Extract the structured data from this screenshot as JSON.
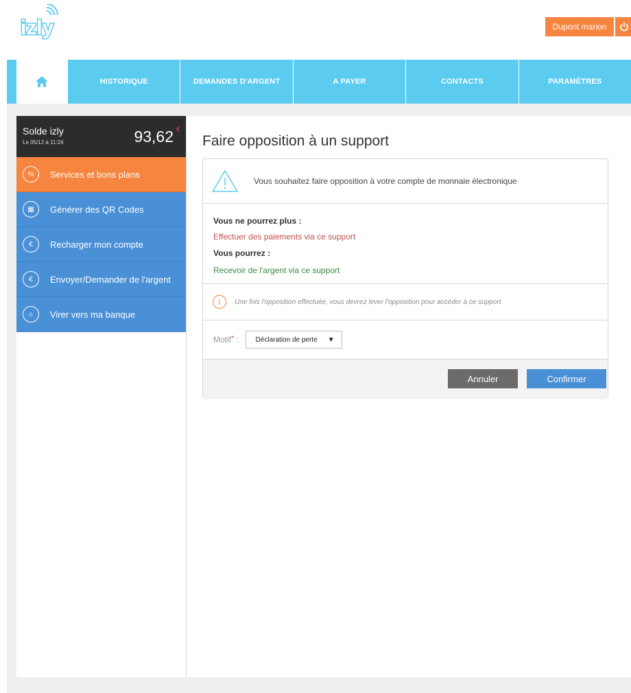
{
  "header": {
    "logo_text": "izly",
    "user_label": "Dupont marion",
    "icons": {
      "logo": "izly-logo",
      "power": "power-icon"
    }
  },
  "nav": {
    "home_icon": "home-icon",
    "items": [
      "HISTORIQUE",
      "DEMANDES D'ARGENT",
      "A PAYER",
      "CONTACTS",
      "PARAMÈTRES"
    ]
  },
  "sidebar": {
    "balance_label": "Solde izly",
    "balance_date": "Le 05/12 à 11:24",
    "balance_amount": "93,62",
    "balance_currency": "€",
    "items": [
      {
        "label": "Services et bons plans",
        "icon": "percent-icon",
        "glyph": "%"
      },
      {
        "label": "Générer des QR Codes",
        "icon": "qr-code-icon",
        "glyph": "▦"
      },
      {
        "label": "Recharger mon compte",
        "icon": "euro-refresh-icon",
        "glyph": "€"
      },
      {
        "label": "Envoyer/Demander de l'argent",
        "icon": "euro-send-icon",
        "glyph": "€"
      },
      {
        "label": "Virer vers ma banque",
        "icon": "bank-icon",
        "glyph": "⌂"
      }
    ]
  },
  "main": {
    "title": "Faire opposition à un support",
    "warning": "Vous souhaitez faire opposition à votre compte de monnaie électronique",
    "cannot_label": "Vous ne pourrez plus :",
    "cannot_item": "Effectuer des paiements via ce support",
    "can_label": "Vous pourrez :",
    "can_item": "Recevoir de l'argent via ce support",
    "note_glyph": "i",
    "note": "Une fois l'opposition effectuée, vous devrez lever l'opposition pour accéder à ce support",
    "motif_label": "Motif",
    "motif_required": "*",
    "motif_colon": " :",
    "motif_value": "Déclaration de perte",
    "cancel_label": "Annuler",
    "confirm_label": "Confirmer"
  },
  "colors": {
    "nav_blue": "#5ccbf0",
    "orange": "#f5853f",
    "side_blue": "#4a90d6",
    "dark": "#2c2c2c",
    "red_text": "#c0504d",
    "green_text": "#3c8a43"
  }
}
